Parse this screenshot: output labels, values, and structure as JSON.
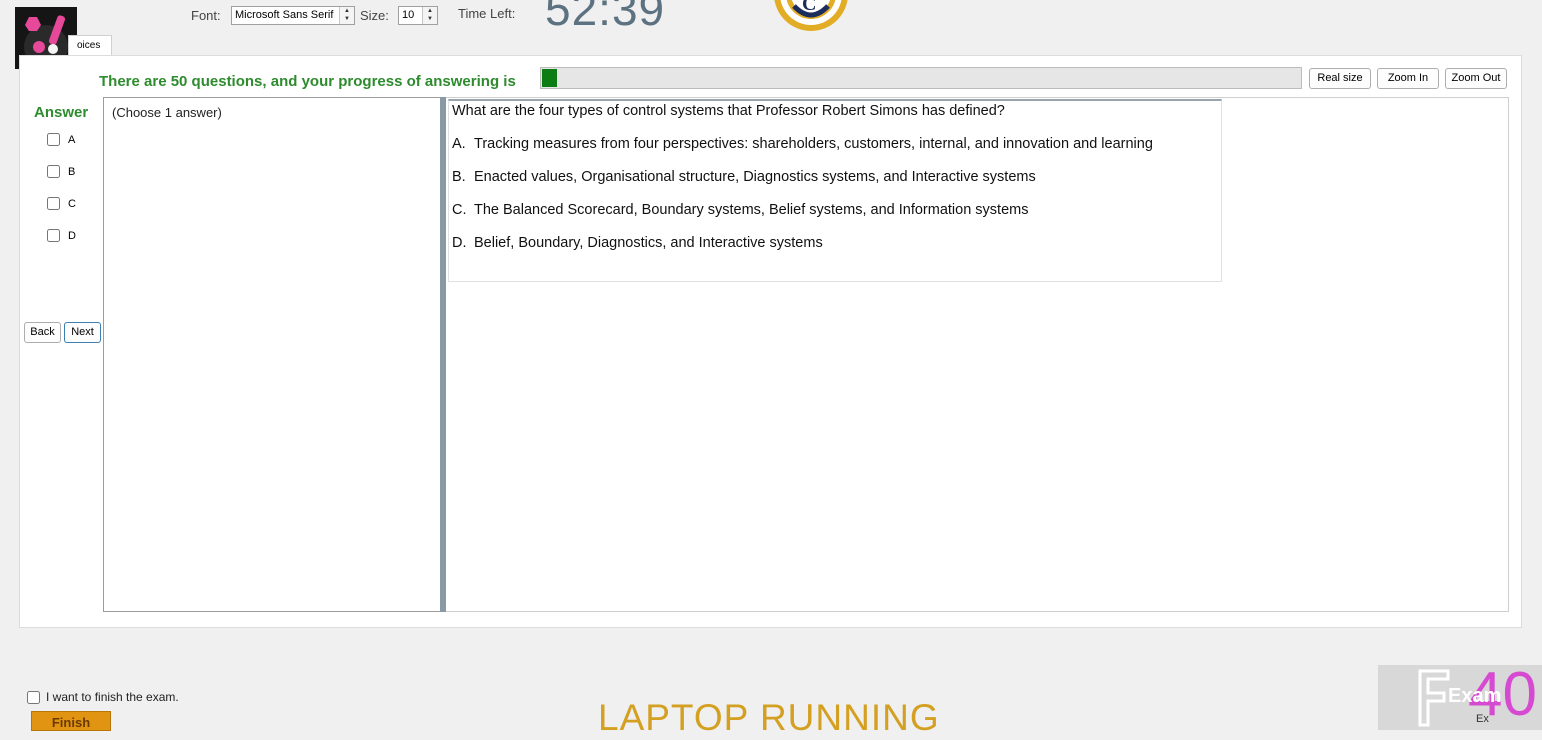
{
  "toolbar": {
    "font_label": "Font:",
    "font_value": "Microsoft Sans Serif",
    "size_label": "Size:",
    "size_value": "10",
    "time_left_label": "Time Left:",
    "timer": "52:39"
  },
  "tab": {
    "label": "oices"
  },
  "progress": {
    "text": "There are 50 questions, and your progress of answering is",
    "fraction": 0.02,
    "color": "#0b7d14"
  },
  "zoom": {
    "real_size": "Real size",
    "zoom_in": "Zoom In",
    "zoom_out": "Zoom Out"
  },
  "answer": {
    "title": "Answer",
    "options": [
      "A",
      "B",
      "C",
      "D"
    ]
  },
  "nav": {
    "back": "Back",
    "next": "Next"
  },
  "question": {
    "instruction": "(Choose 1 answer)",
    "text": "What are the four types of control systems that Professor Robert Simons has defined?",
    "options": [
      {
        "letter": "A.",
        "text": "Tracking measures from four perspectives: shareholders, customers, internal, and innovation and learning"
      },
      {
        "letter": "B.",
        "text": "Enacted values, Organisational structure, Diagnostics systems, and Interactive systems"
      },
      {
        "letter": "C.",
        "text": "The Balanced Scorecard, Boundary systems, Belief systems, and Information systems"
      },
      {
        "letter": "D.",
        "text": "Belief, Boundary, Diagnostics, and Interactive systems"
      }
    ]
  },
  "footer": {
    "finish_check_label": "I want to finish the exam.",
    "finish_button": "Finish",
    "banner": "LAPTOP RUNNING",
    "corner_number": "40",
    "corner_exam": "Exam",
    "corner_ex": "Ex"
  },
  "icons": {
    "app_logo": "tools-logo-icon",
    "club_crest": "club-crest-icon"
  },
  "colors": {
    "accent_green": "#2e8b2e",
    "finish_orange": "#e09412",
    "banner_gold": "#d4a021",
    "timer_slate": "#5d7281"
  }
}
